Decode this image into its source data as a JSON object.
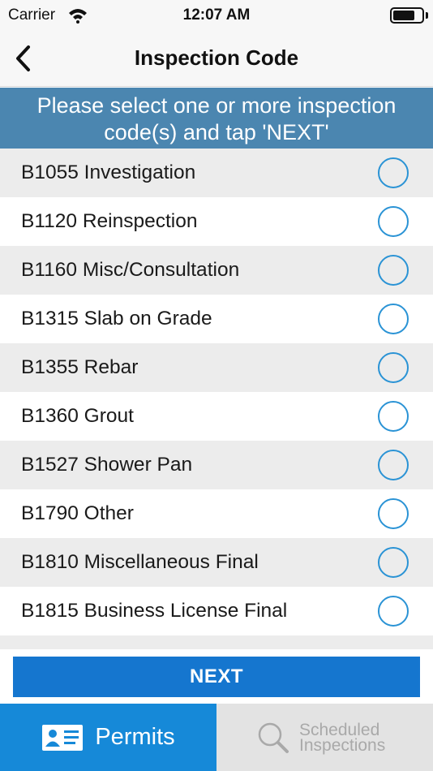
{
  "status_bar": {
    "carrier": "Carrier",
    "time": "12:07 AM"
  },
  "nav": {
    "title": "Inspection Code"
  },
  "banner": {
    "line1": "Please select one or more inspection",
    "line2": "code(s) and tap 'NEXT'"
  },
  "codes": [
    {
      "label": "B1055 Investigation",
      "selected": false
    },
    {
      "label": "B1120 Reinspection",
      "selected": false
    },
    {
      "label": "B1160 Misc/Consultation",
      "selected": false
    },
    {
      "label": "B1315 Slab on Grade",
      "selected": false
    },
    {
      "label": "B1355 Rebar",
      "selected": false
    },
    {
      "label": "B1360 Grout",
      "selected": false
    },
    {
      "label": "B1527 Shower Pan",
      "selected": false
    },
    {
      "label": "B1790 Other",
      "selected": false
    },
    {
      "label": "B1810 Miscellaneous Final",
      "selected": false
    },
    {
      "label": "B1815 Business License Final",
      "selected": false
    },
    {
      "label": "",
      "selected": false
    }
  ],
  "next_button": {
    "label": "NEXT"
  },
  "tabs": {
    "permits": {
      "label": "Permits",
      "icon": "id-card-icon",
      "active": true
    },
    "scheduled": {
      "label_line1": "Scheduled",
      "label_line2": "Inspections",
      "icon": "search-icon",
      "active": false
    }
  },
  "colors": {
    "banner": "#4b86b0",
    "radio_border": "#2a93d5",
    "next_button": "#1576cf",
    "tab_active": "#1689d8",
    "tab_inactive": "#e3e3e3"
  }
}
